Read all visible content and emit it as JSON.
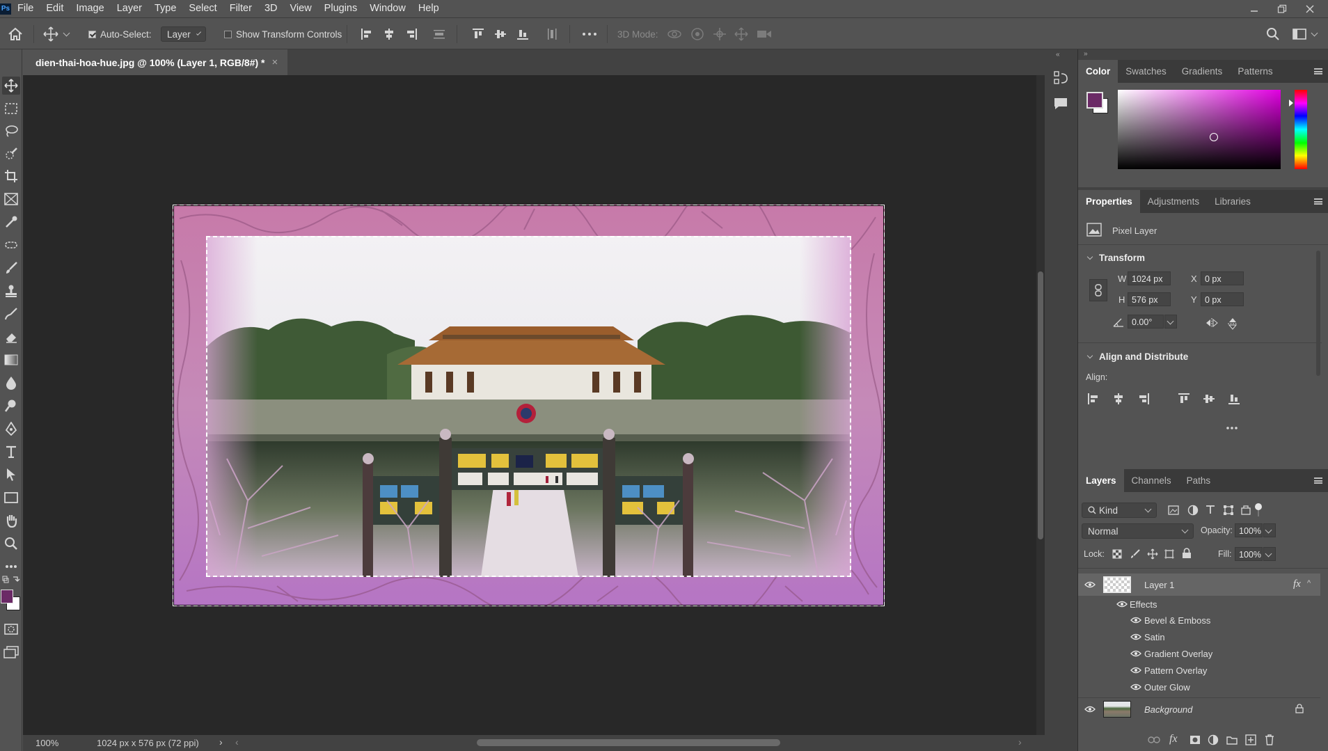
{
  "app": {
    "logo": "Ps"
  },
  "menu": [
    "File",
    "Edit",
    "Image",
    "Layer",
    "Type",
    "Select",
    "Filter",
    "3D",
    "View",
    "Plugins",
    "Window",
    "Help"
  ],
  "options_bar": {
    "auto_select_label": "Auto-Select:",
    "auto_select_checked": true,
    "auto_select_target": "Layer",
    "show_transform_label": "Show Transform Controls",
    "show_transform_checked": false,
    "three_d_mode_label": "3D Mode:"
  },
  "document": {
    "tab_title": "dien-thai-hoa-hue.jpg @ 100% (Layer 1, RGB/8#) *",
    "zoom": "100%",
    "doc_info": "1024 px x 576 px (72 ppi)"
  },
  "colors": {
    "foreground": "#6b2a66",
    "background": "#ffffff",
    "frame_tint": "#b46aa8"
  },
  "color_panel": {
    "tabs": [
      "Color",
      "Swatches",
      "Gradients",
      "Patterns"
    ],
    "active": "Color"
  },
  "properties_panel": {
    "tabs": [
      "Properties",
      "Adjustments",
      "Libraries"
    ],
    "active": "Properties",
    "layer_type": "Pixel Layer",
    "transform_title": "Transform",
    "w_label": "W",
    "w_value": "1024 px",
    "h_label": "H",
    "h_value": "576 px",
    "x_label": "X",
    "x_value": "0 px",
    "y_label": "Y",
    "y_value": "0 px",
    "angle_value": "0.00°",
    "align_title": "Align and Distribute",
    "align_label": "Align:"
  },
  "layers_panel": {
    "tabs": [
      "Layers",
      "Channels",
      "Paths"
    ],
    "active": "Layers",
    "filter_kind": "Kind",
    "blend_mode": "Normal",
    "opacity_label": "Opacity:",
    "opacity_value": "100%",
    "lock_label": "Lock:",
    "fill_label": "Fill:",
    "fill_value": "100%",
    "layers": [
      {
        "name": "Layer 1",
        "fx": "fx",
        "effects_label": "Effects",
        "effects": [
          "Bevel & Emboss",
          "Satin",
          "Gradient Overlay",
          "Pattern Overlay",
          "Outer Glow"
        ]
      },
      {
        "name": "Background",
        "locked": true
      }
    ]
  }
}
